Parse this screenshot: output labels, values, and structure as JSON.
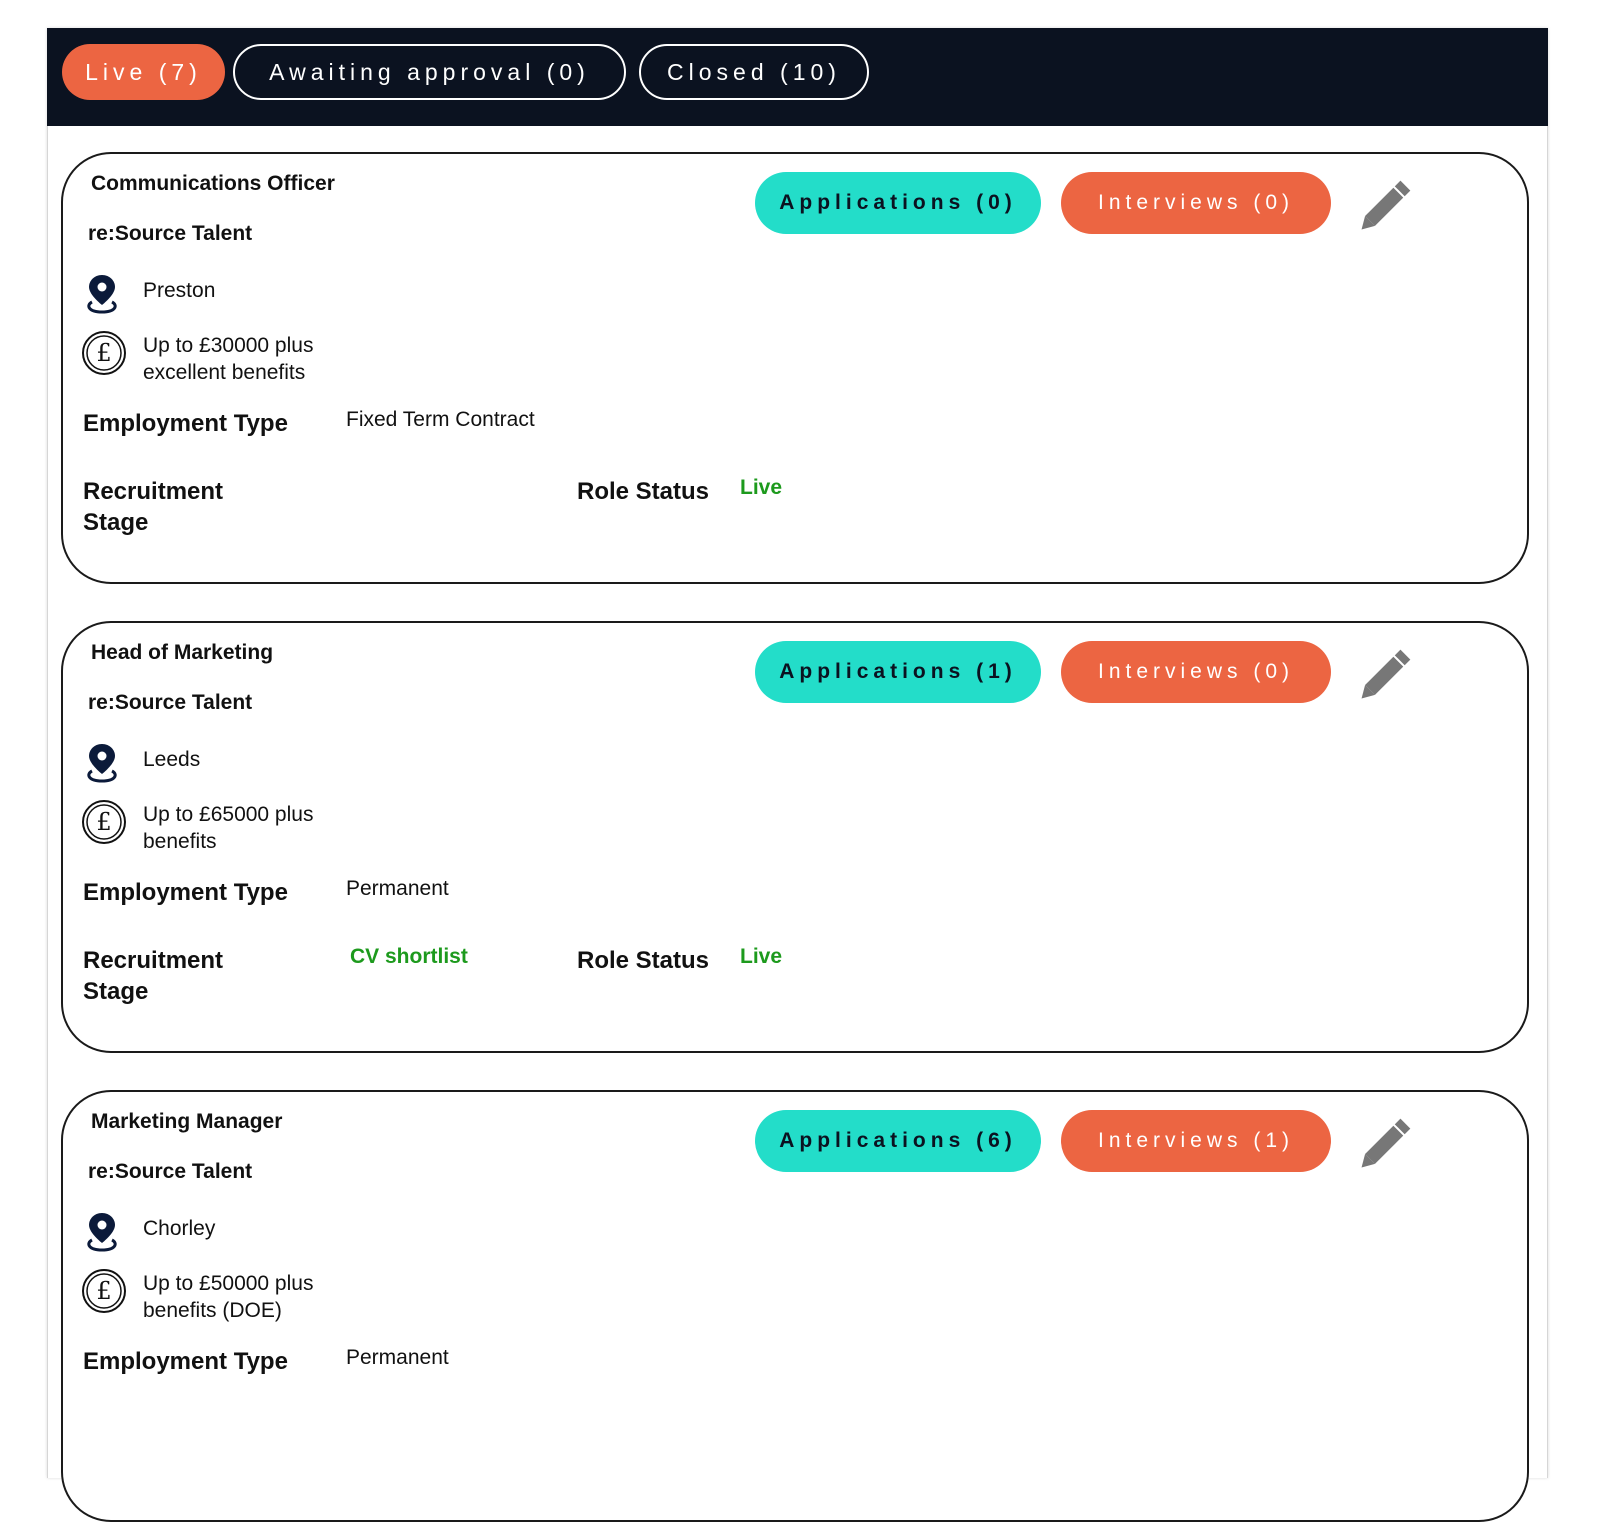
{
  "tabs": [
    {
      "label": "Live (7)"
    },
    {
      "label": "Awaiting approval (0)"
    },
    {
      "label": "Closed (10)"
    }
  ],
  "labels": {
    "employment_type": "Employment Type",
    "recruitment_stage": "Recruitment Stage",
    "role_status": "Role Status"
  },
  "colors": {
    "accent_orange": "#ec6542",
    "accent_teal": "#23ddc9",
    "header_bg": "#0b1220",
    "status_green": "#1d9a1d"
  },
  "jobs": [
    {
      "title": "Communications Officer",
      "company": "re:Source Talent",
      "location": "Preston",
      "salary": "Up to £30000 plus excellent benefits",
      "employment_type": "Fixed Term Contract",
      "recruitment_stage": "",
      "role_status": "Live",
      "applications_label": "Applications (0)",
      "interviews_label": "Interviews (0)",
      "edit_icon": "pencil-icon"
    },
    {
      "title": "Head of Marketing",
      "company": "re:Source Talent",
      "location": "Leeds",
      "salary": "Up to £65000 plus benefits",
      "employment_type": "Permanent",
      "recruitment_stage": "CV shortlist",
      "role_status": "Live",
      "applications_label": "Applications (1)",
      "interviews_label": "Interviews (0)",
      "edit_icon": "pencil-icon"
    },
    {
      "title": "Marketing Manager",
      "company": "re:Source Talent",
      "location": "Chorley",
      "salary": "Up to £50000 plus benefits (DOE)",
      "employment_type": "Permanent",
      "recruitment_stage": "",
      "role_status": "",
      "applications_label": "Applications (6)",
      "interviews_label": "Interviews (1)",
      "edit_icon": "pencil-icon"
    }
  ]
}
